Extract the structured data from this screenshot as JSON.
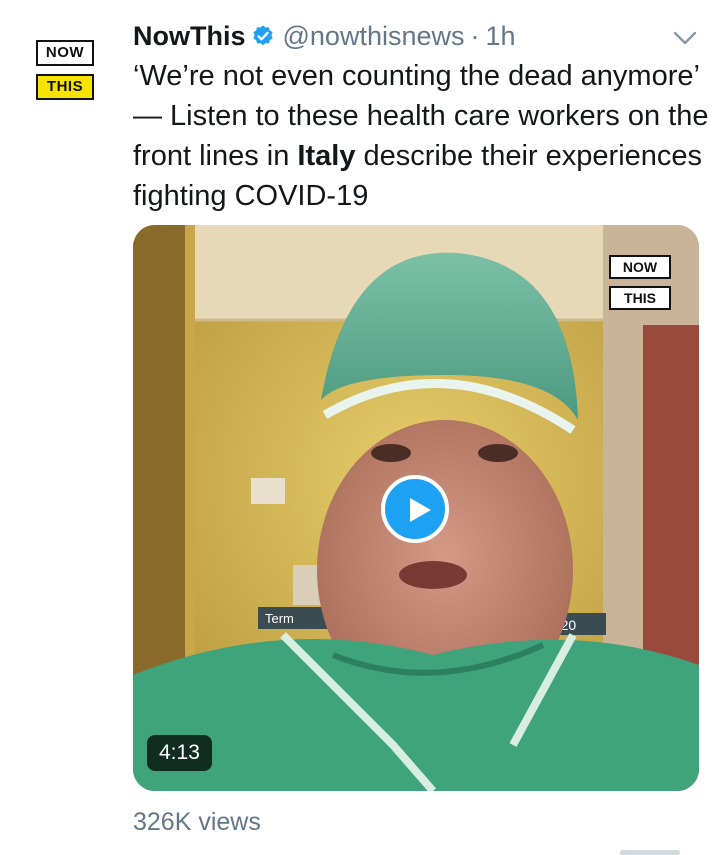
{
  "account": {
    "name": "NowThis",
    "handle": "@nowthisnews",
    "separator": "·",
    "time": "1h",
    "verified_icon": "verified-badge-icon",
    "avatar_logo": {
      "top": "NOW",
      "bottom": "THIS"
    }
  },
  "tweet": {
    "text_before": "‘We’re not even counting the dead anymore’ — Listen to these health care workers on the front lines in ",
    "text_bold": "Italy",
    "text_after": " describe their experiences fighting COVID-19"
  },
  "video": {
    "watermark": {
      "top": "NOW",
      "bottom": "THIS"
    },
    "duration": "4:13",
    "play_icon": "play-icon",
    "scene_text": {
      "left_sign": "Term",
      "right_sign": "2020"
    }
  },
  "stats": {
    "views": "326K views"
  },
  "colors": {
    "accent": "#1da1f2",
    "secondary_text": "#657786",
    "logo_yellow": "#f7e300"
  }
}
